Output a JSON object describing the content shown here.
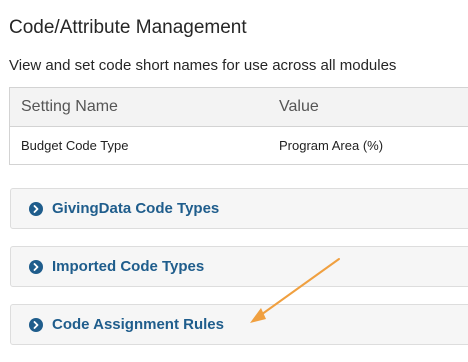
{
  "page": {
    "title": "Code/Attribute Management",
    "description": "View and set code short names for use across all modules"
  },
  "table": {
    "headers": [
      "Setting Name",
      "Value"
    ],
    "rows": [
      {
        "setting": "Budget Code Type",
        "value": "Program Area (%)"
      }
    ]
  },
  "sections": [
    {
      "label": "GivingData Code Types",
      "icon": "chevron-right-circle-icon"
    },
    {
      "label": "Imported Code Types",
      "icon": "chevron-right-circle-icon"
    },
    {
      "label": "Code Assignment Rules",
      "icon": "chevron-right-circle-icon"
    }
  ],
  "annotation": {
    "type": "arrow",
    "color": "#f0a040",
    "points_to": "Code Assignment Rules"
  },
  "colors": {
    "accent": "#1f5d8c",
    "header_bg": "#f3f3f3",
    "section_bg": "#f6f6f6"
  }
}
